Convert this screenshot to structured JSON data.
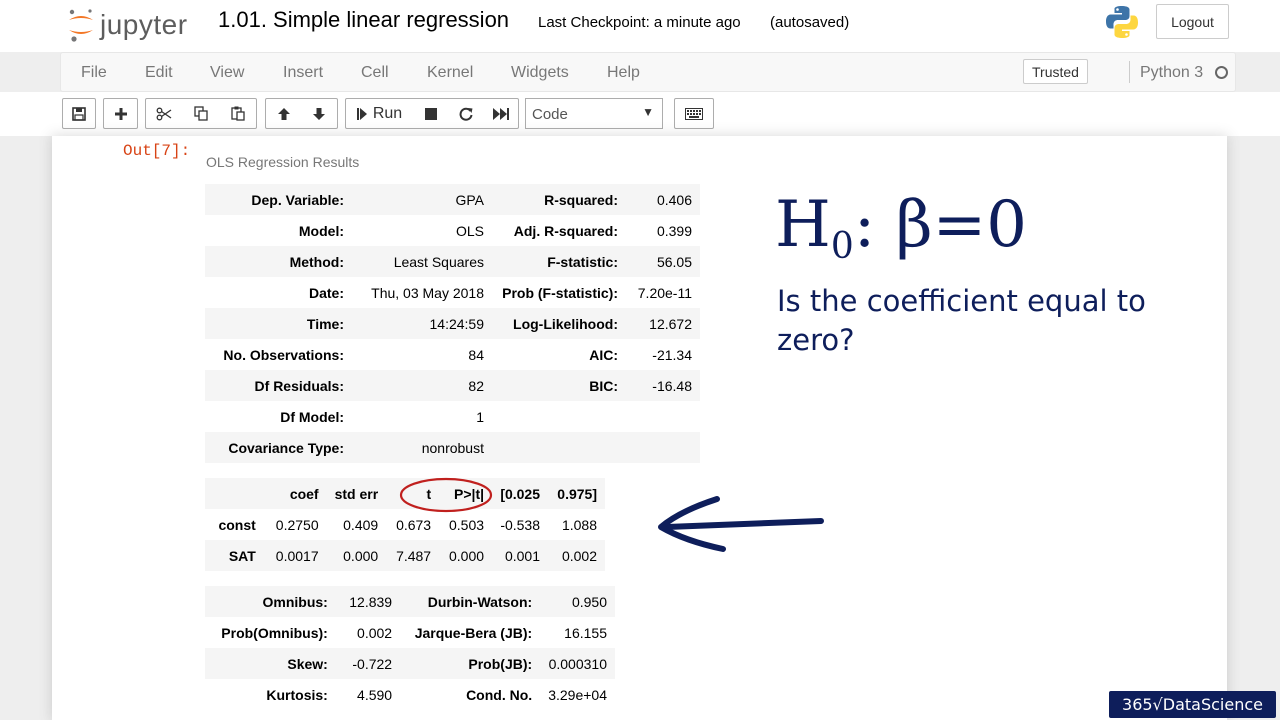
{
  "header": {
    "logo_text": "jupyter",
    "notebook_title": "1.01. Simple linear regression",
    "checkpoint": "Last Checkpoint: a minute ago",
    "autosaved": "(autosaved)",
    "logout_label": "Logout"
  },
  "menubar": {
    "items": [
      "File",
      "Edit",
      "View",
      "Insert",
      "Cell",
      "Kernel",
      "Widgets",
      "Help"
    ],
    "trusted_label": "Trusted",
    "kernel_name": "Python 3"
  },
  "toolbar": {
    "run_label": "Run",
    "cell_type": "Code",
    "icons": [
      "save-icon",
      "plus-icon",
      "scissors-icon",
      "copy-icon",
      "paste-icon",
      "arrow-up-icon",
      "arrow-down-icon",
      "run-icon",
      "stop-icon",
      "restart-icon",
      "fast-forward-icon",
      "keyboard-icon"
    ]
  },
  "output": {
    "prompt": "Out[7]:",
    "caption": "OLS Regression Results",
    "summary_table": [
      [
        "Dep. Variable:",
        "GPA",
        "R-squared:",
        "0.406"
      ],
      [
        "Model:",
        "OLS",
        "Adj. R-squared:",
        "0.399"
      ],
      [
        "Method:",
        "Least Squares",
        "F-statistic:",
        "56.05"
      ],
      [
        "Date:",
        "Thu, 03 May 2018",
        "Prob (F-statistic):",
        "7.20e-11"
      ],
      [
        "Time:",
        "14:24:59",
        "Log-Likelihood:",
        "12.672"
      ],
      [
        "No. Observations:",
        "84",
        "AIC:",
        "-21.34"
      ],
      [
        "Df Residuals:",
        "82",
        "BIC:",
        "-16.48"
      ],
      [
        "Df Model:",
        "1",
        "",
        ""
      ],
      [
        "Covariance Type:",
        "nonrobust",
        "",
        ""
      ]
    ],
    "coef_table": {
      "headers": [
        "",
        "coef",
        "std err",
        "t",
        "P>|t|",
        "[0.025",
        "0.975]"
      ],
      "rows": [
        [
          "const",
          "0.2750",
          "0.409",
          "0.673",
          "0.503",
          "-0.538",
          "1.088"
        ],
        [
          "SAT",
          "0.0017",
          "0.000",
          "7.487",
          "0.000",
          "0.001",
          "0.002"
        ]
      ]
    },
    "diag_table": [
      [
        "Omnibus:",
        "12.839",
        "Durbin-Watson:",
        "0.950"
      ],
      [
        "Prob(Omnibus):",
        "0.002",
        "Jarque-Bera (JB):",
        "16.155"
      ],
      [
        "Skew:",
        "-0.722",
        "Prob(JB):",
        "0.000310"
      ],
      [
        "Kurtosis:",
        "4.590",
        "Cond. No.",
        "3.29e+04"
      ]
    ]
  },
  "annotation": {
    "hypothesis_h": "H",
    "hypothesis_sub": "0",
    "hypothesis_rest": ": β=0",
    "question": "Is the coefficient equal to zero?",
    "color": "#0e1e5b"
  },
  "watermark": "365√DataScience"
}
